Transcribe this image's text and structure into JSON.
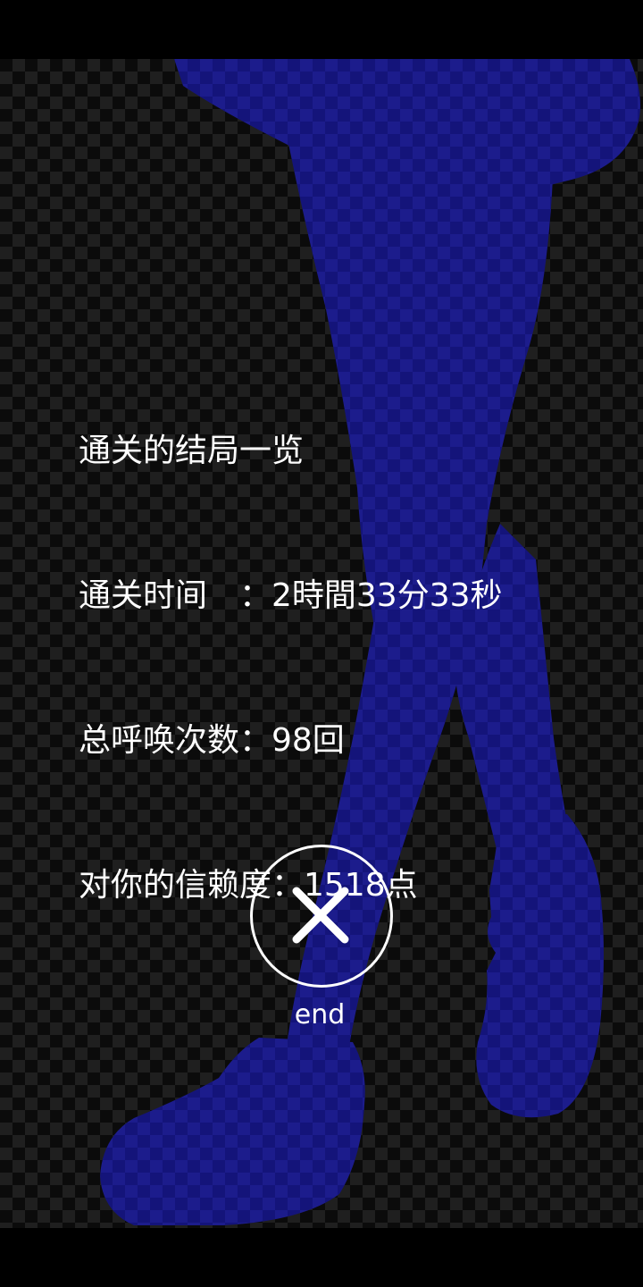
{
  "results": {
    "heading": "通关的结局一览",
    "clear_time": "通关时间　：2時間33分33秒",
    "summon_count": "总呼唤次数：98回",
    "trust_level": "对你的信赖度：1518点"
  },
  "end_button": {
    "label": "end",
    "icon": "close-icon"
  },
  "colors": {
    "silhouette": "#14147a",
    "text": "#ffffff",
    "background": "#000000"
  }
}
